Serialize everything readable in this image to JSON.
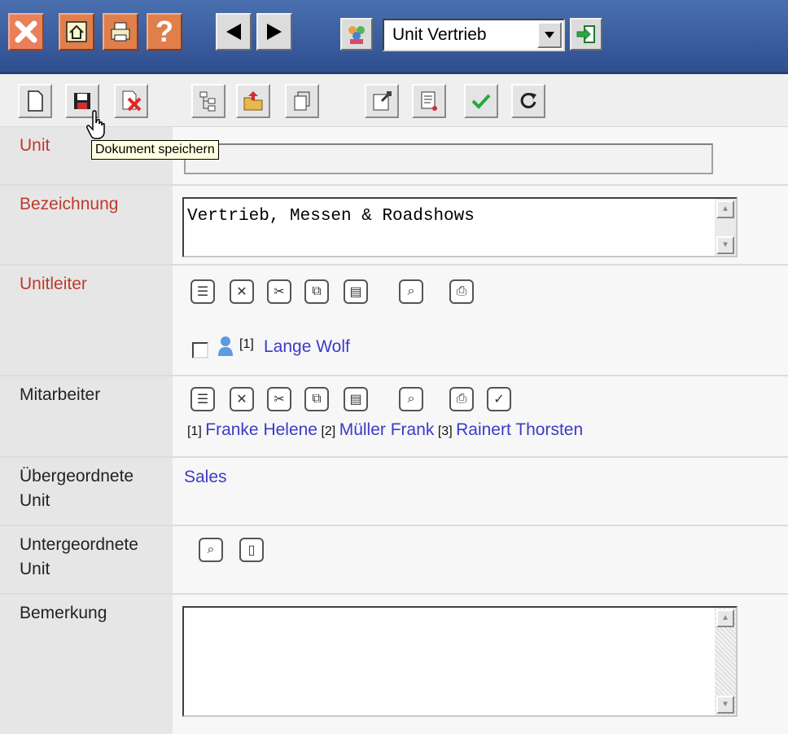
{
  "header": {
    "unit_select_value": "Unit Vertrieb",
    "icons": [
      "close-icon",
      "home-icon",
      "print-icon",
      "help-icon",
      "back-arrow-icon",
      "forward-arrow-icon",
      "users-icon",
      "enter-icon"
    ]
  },
  "toolbar": {
    "tooltip": "Dokument speichern",
    "icons": [
      "new-document-icon",
      "save-icon",
      "delete-icon",
      "tree-icon",
      "folder-import-icon",
      "copy-icon",
      "properties-icon",
      "list-icon",
      "check-icon",
      "refresh-icon"
    ]
  },
  "form": {
    "unit": {
      "label": "Unit",
      "value": ""
    },
    "bezeichnung": {
      "label": "Bezeichnung",
      "value": "Vertrieb, Messen & Roadshows"
    },
    "unitleiter": {
      "label": "Unitleiter",
      "person_index": "[1]",
      "person_name": "Lange Wolf"
    },
    "mitarbeiter": {
      "label": "Mitarbeiter",
      "people": [
        {
          "index": "[1]",
          "name": "Franke Helene"
        },
        {
          "index": "[2]",
          "name": "Müller Frank"
        },
        {
          "index": "[3]",
          "name": "Rainert Thorsten"
        }
      ]
    },
    "uebergeordnete": {
      "label_line1": "Übergeordnete",
      "label_line2": "Unit",
      "value": "Sales"
    },
    "untergeordnete": {
      "label_line1": "Untergeordnete",
      "label_line2": "Unit"
    },
    "bemerkung": {
      "label": "Bemerkung",
      "value": ""
    }
  },
  "colors": {
    "header_blue": "#3b5d9e",
    "required_label": "#c0392b",
    "link": "#3b3bc8"
  }
}
